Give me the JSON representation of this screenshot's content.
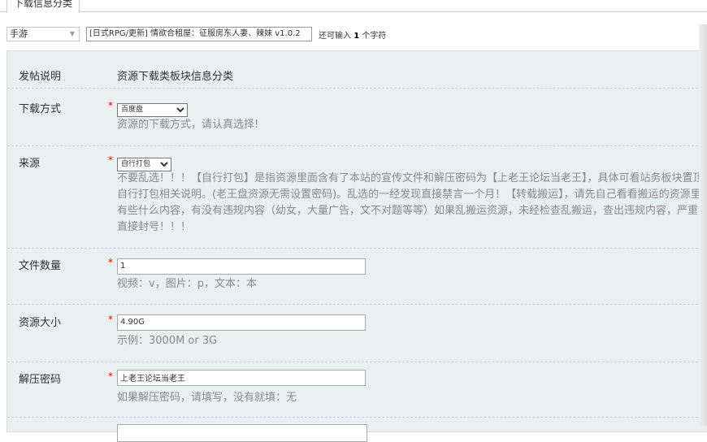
{
  "tab": {
    "label": "下载信息分类"
  },
  "title_row": {
    "type_select": "手游",
    "title_value": "[日式RPG/更新] 情欲合租屋：征服房东人妻、辣妹 v1.0.2",
    "count_prefix": "还可输入",
    "count_value": "1",
    "count_suffix": "个字符"
  },
  "form": {
    "post_note": {
      "label": "发帖说明",
      "value": "资源下载类板块信息分类"
    },
    "download_method": {
      "label": "下载方式",
      "required": "*",
      "selected": "百度盘",
      "hint": "资源的下载方式，请认真选择!"
    },
    "source": {
      "label": "来源",
      "required": "*",
      "selected": "自行打包",
      "hint": "不要乱选！！！【自行打包】是指资源里面含有了本站的宣传文件和解压密码为【上老王论坛当老王】，具体可看站务板块置顶帖自行打包相关说明。(老王盘资源无需设置密码)。乱选的一经发现直接禁言一个月！【转载搬运】，请先自己看看搬运的资源里面有些什么内容，有没有违规内容（幼女，大量广告，文不对题等等）如果乱搬运资源，未经检查乱搬运，查出违规内容，严重者直接封号！！！"
    },
    "file_count": {
      "label": "文件数量",
      "required": "*",
      "value": "1",
      "hint": "视频：v，图片：p，文本：本"
    },
    "resource_size": {
      "label": "资源大小",
      "required": "*",
      "value": "4.90G",
      "hint": "示例：3000M or 3G"
    },
    "unzip_password": {
      "label": "解压密码",
      "required": "*",
      "value": "上老王论坛当老王",
      "hint": "如果解压密码，请填写，没有就填：无"
    }
  }
}
